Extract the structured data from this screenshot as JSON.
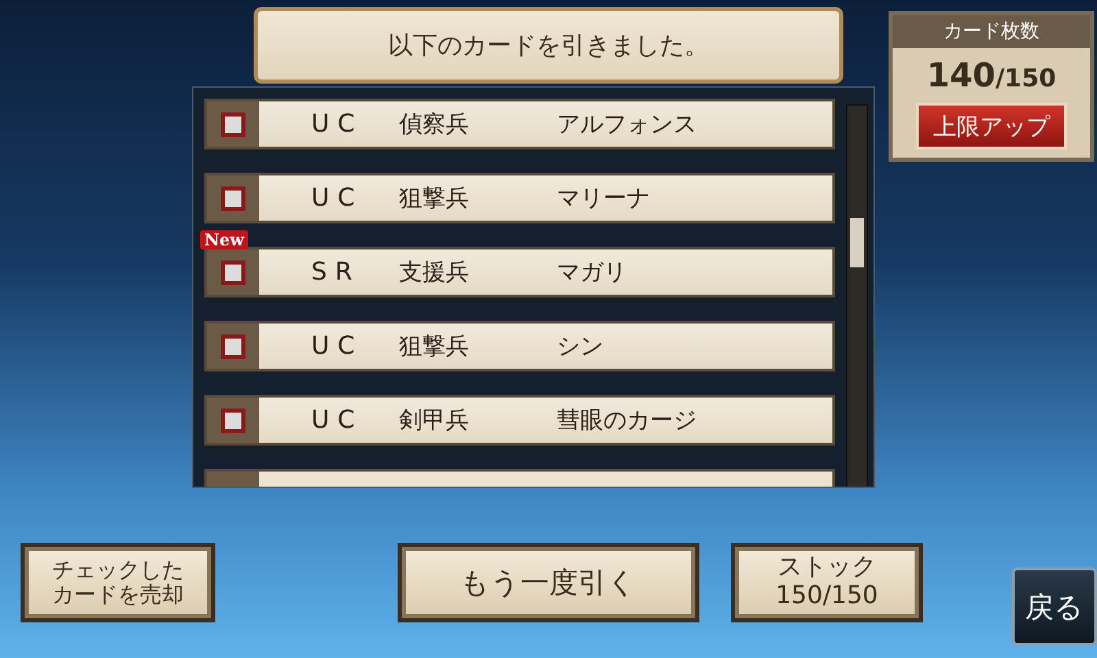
{
  "banner": {
    "title": "以下のカードを引きました。"
  },
  "cards": [
    {
      "rarity": "UC",
      "class": "偵察兵",
      "name": "アルフォンス",
      "checked": false
    },
    {
      "rarity": "UC",
      "class": "狙撃兵",
      "name": "マリーナ",
      "checked": false
    },
    {
      "rarity": "SR",
      "class": "支援兵",
      "name": "マガリ",
      "checked": false,
      "badge": "New"
    },
    {
      "rarity": "UC",
      "class": "狙撃兵",
      "name": "シン",
      "checked": false
    },
    {
      "rarity": "UC",
      "class": "剣甲兵",
      "name": "彗眼のカージ",
      "checked": false
    }
  ],
  "card_count": {
    "label": "カード枚数",
    "count": "140",
    "max": "/150",
    "button": "上限アップ"
  },
  "buttons": {
    "sell": [
      "チェックした",
      "カードを売却"
    ],
    "draw_again": "もう一度引く",
    "stock": [
      "ストック",
      "150/150"
    ],
    "back": "戻る"
  }
}
